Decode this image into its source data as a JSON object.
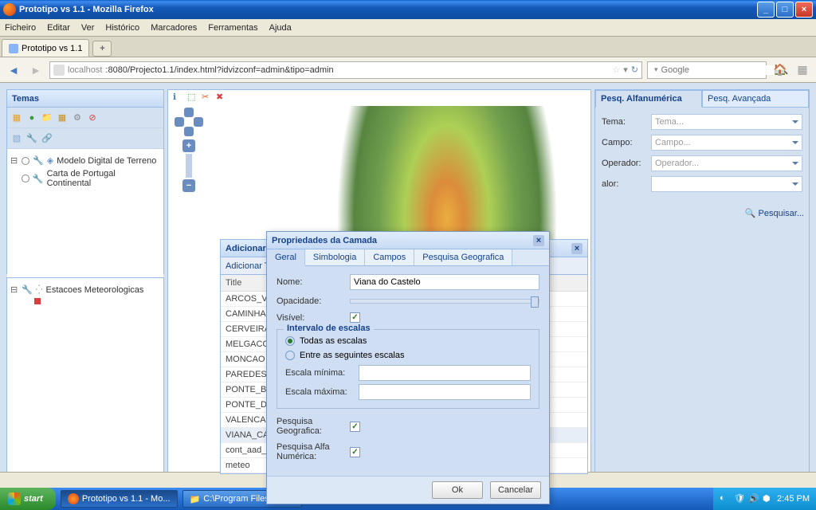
{
  "window": {
    "title": "Prototipo vs 1.1 - Mozilla Firefox"
  },
  "menubar": {
    "file": "Ficheiro",
    "edit": "Editar",
    "view": "Ver",
    "history": "Histórico",
    "bookmarks": "Marcadores",
    "tools": "Ferramentas",
    "help": "Ajuda"
  },
  "tabstrip": {
    "tab1": "Prototipo vs 1.1",
    "newtab": "+"
  },
  "url": {
    "host": "localhost",
    "port_path": ":8080/Projecto1.1/index.html?idvizconf=admin&tipo=admin"
  },
  "searchbox": {
    "placeholder": "Google"
  },
  "temas": {
    "title": "Temas",
    "tree1": {
      "item1": "Modelo Digital de Terreno",
      "item2": "Carta de Portugal Continental"
    },
    "tree2": {
      "item1": "Estacoes Meteorologicas"
    }
  },
  "search_panel": {
    "tab_alpha": "Pesq. Alfanumérica",
    "tab_adv": "Pesq. Avançada",
    "tema_label": "Tema:",
    "tema_ph": "Tema...",
    "campo_label": "Campo:",
    "campo_ph": "Campo...",
    "operador_label": "Operador:",
    "operador_ph": "Operador...",
    "valor_label": "alor:",
    "pesquisar": "Pesquisar..."
  },
  "wms": {
    "title": "Adicionar WMS",
    "subtitle": "Adicionar Tema",
    "col_title": "Title",
    "items": [
      "ARCOS_VAL",
      "CAMINHA",
      "CERVEIRA",
      "MELGACO",
      "MONCAO",
      "PAREDES_C",
      "PONTE_BAR",
      "PONTE_DE_",
      "VALENCA",
      "VIANA_CAS",
      "cont_aad_c",
      "meteo"
    ]
  },
  "dialog": {
    "title": "Propriedades da Camada",
    "tabs": {
      "geral": "Geral",
      "simbologia": "Simbologia",
      "campos": "Campos",
      "pesq_geo": "Pesquisa Geografica"
    },
    "nome_label": "Nome:",
    "nome_value": "Viana do Castelo",
    "opacidade_label": "Opacidade:",
    "visivel_label": "Visível:",
    "fieldset_legend": "Intervalo de escalas",
    "radio_todas": "Todas as escalas",
    "radio_entre": "Entre as seguintes escalas",
    "escala_min": "Escala mínima:",
    "escala_max": "Escala máxima:",
    "pesq_geo_label": "Pesquisa Geografica:",
    "pesq_alfa_label": "Pesquisa Alfa Numérica:",
    "ok": "Ok",
    "cancel": "Cancelar"
  },
  "taskbar": {
    "start": "start",
    "task1": "Prototipo vs 1.1 - Mo...",
    "task2": "C:\\Program Files\\Apa...",
    "clock": "2:45 PM"
  }
}
